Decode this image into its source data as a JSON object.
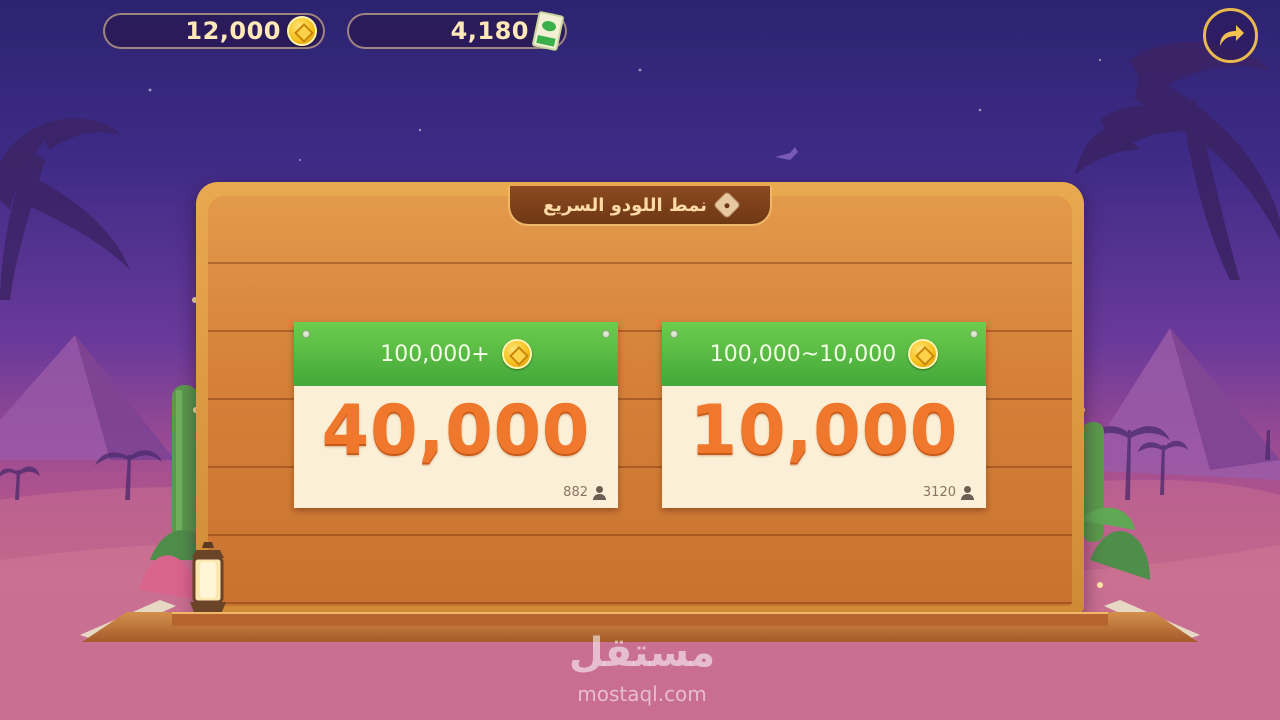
{
  "hud": {
    "coins": "12,000",
    "tickets": "4,180",
    "coin_icon": "gold-coin",
    "ticket_icon": "ticket"
  },
  "board": {
    "title": "نمط اللودو السريع",
    "title_icon": "dice"
  },
  "rooms": [
    {
      "requirement": "100,000+",
      "entry": "40,000",
      "players": "882"
    },
    {
      "requirement": "100,000~10,000",
      "entry": "10,000",
      "players": "3120"
    }
  ],
  "watermark": {
    "arabic": "مستقل",
    "latin": "mostaql.com"
  },
  "colors": {
    "sky_top": "#2c2370",
    "sky_bottom": "#c0607f",
    "card_header_green": "#44a83a",
    "amount_orange": "#f0782c",
    "wood": "#d6823a"
  }
}
